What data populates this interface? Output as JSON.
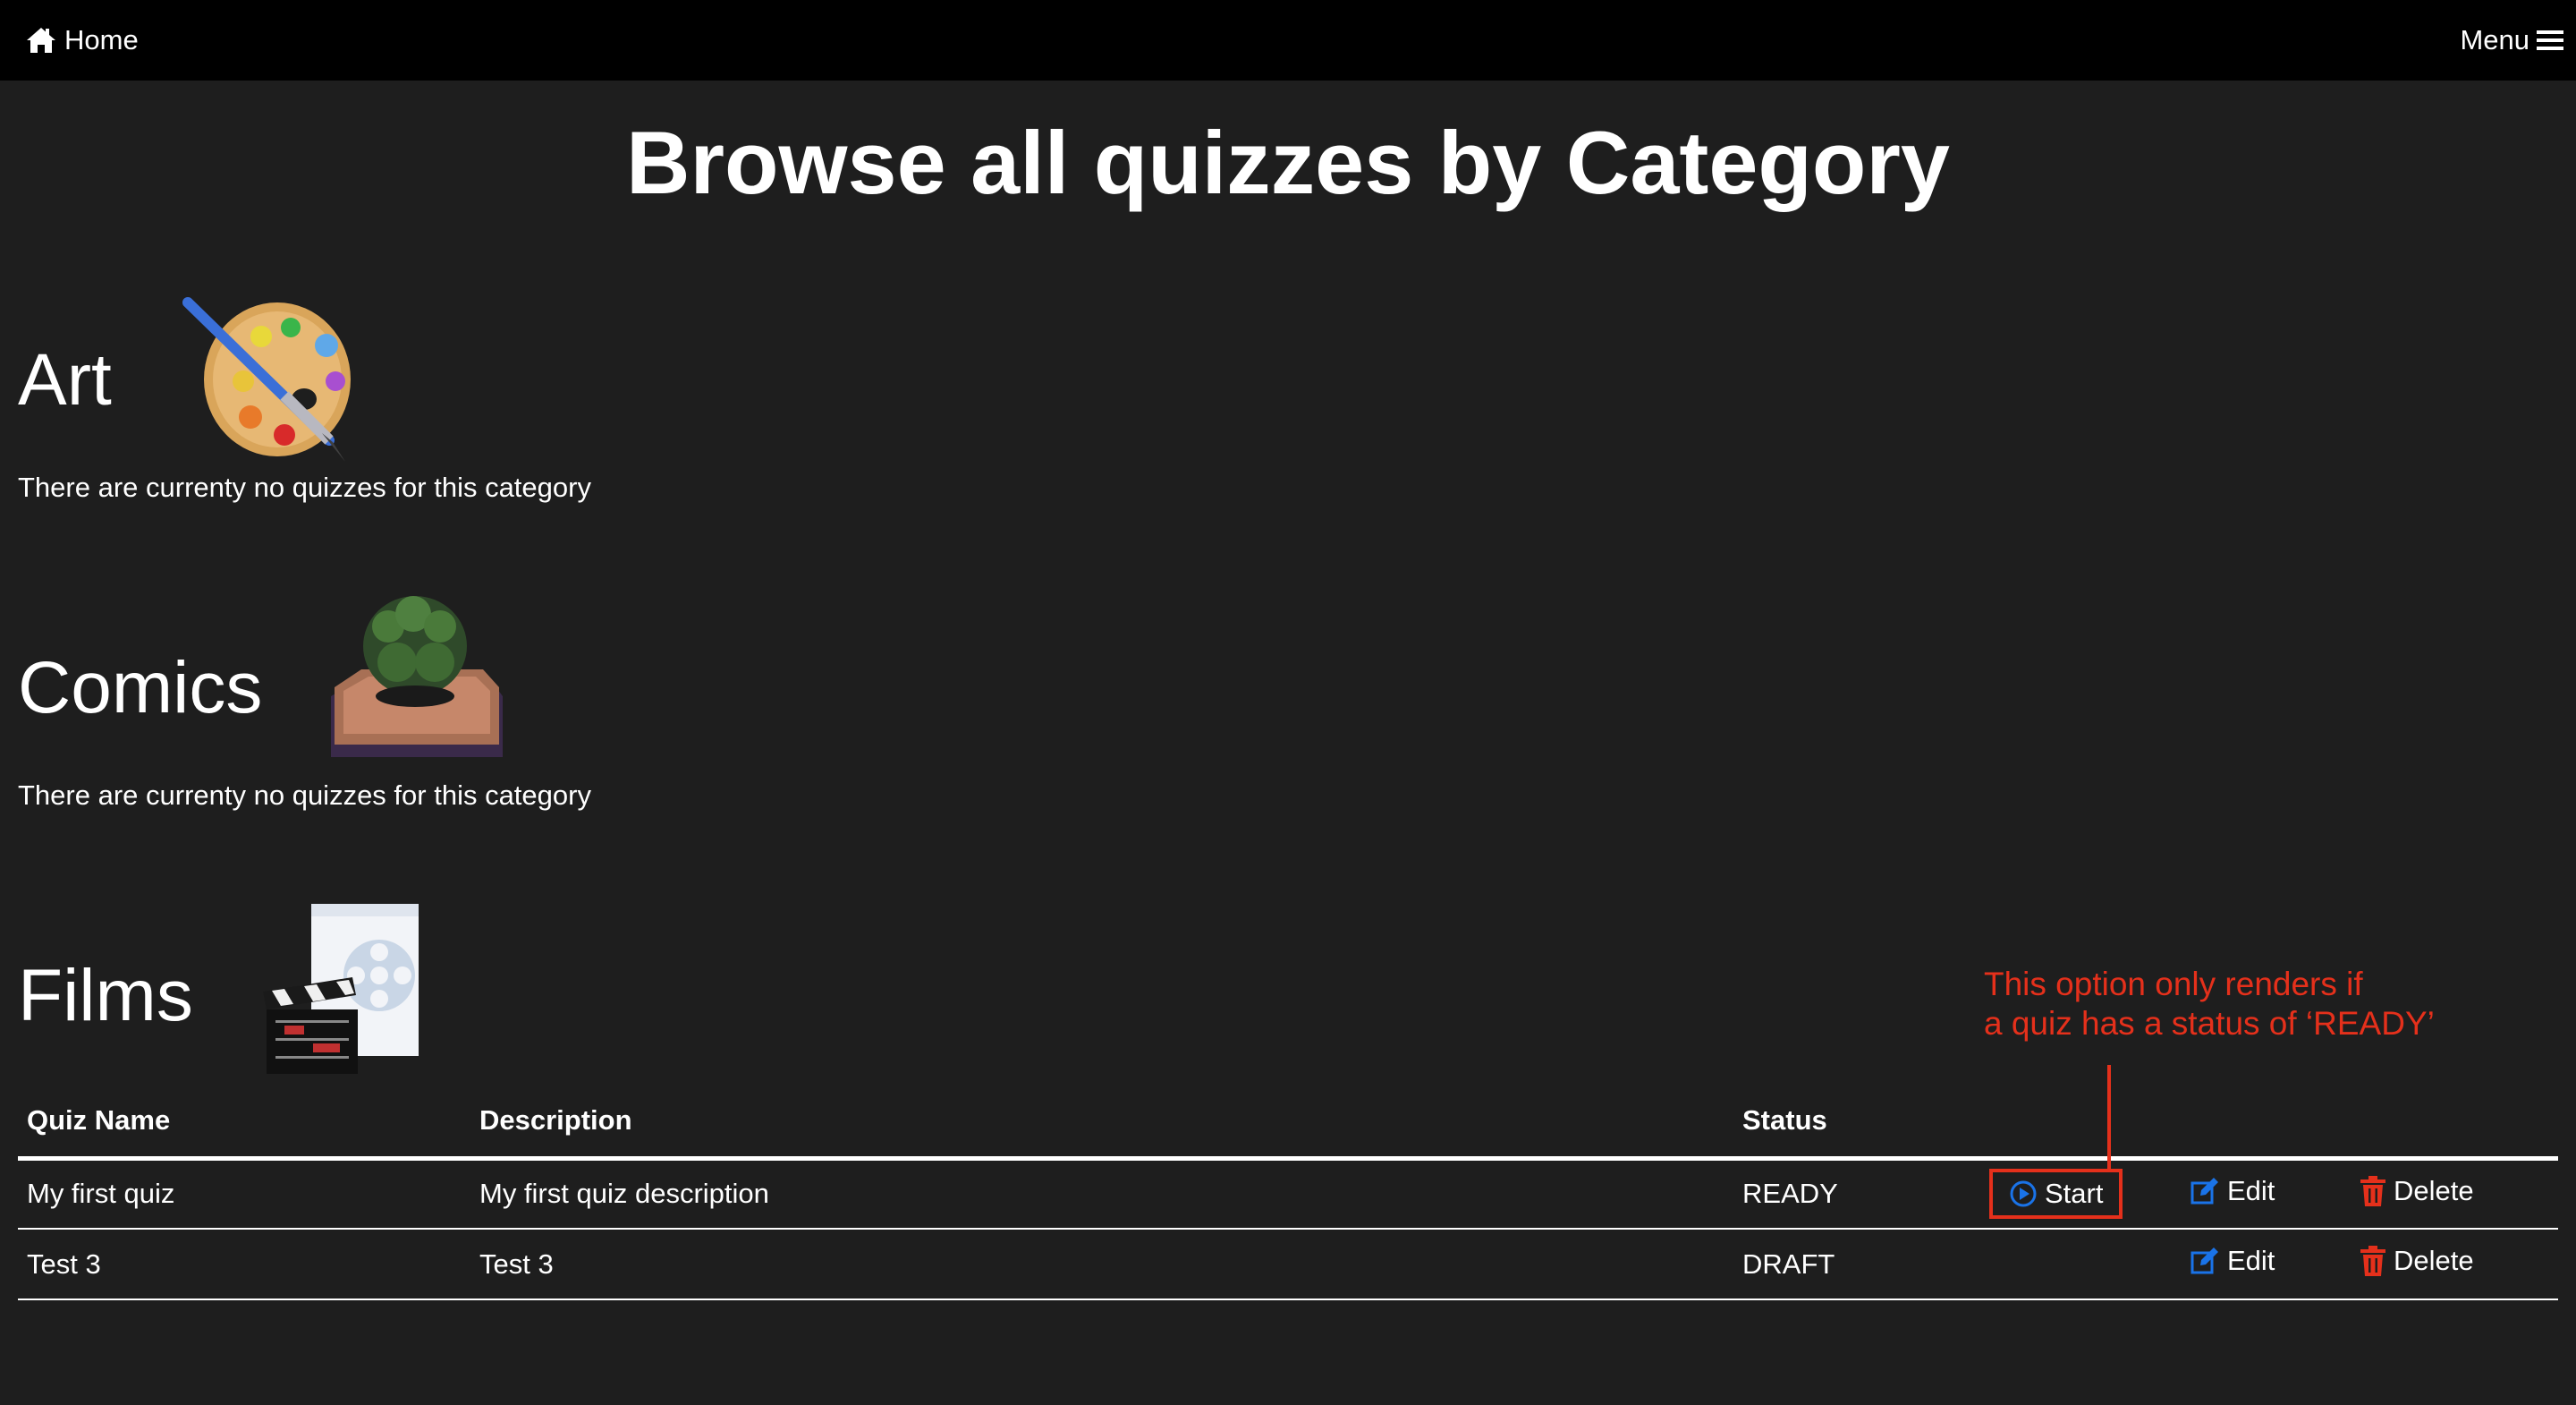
{
  "nav": {
    "home_label": "Home",
    "menu_label": "Menu"
  },
  "page_title": "Browse all quizzes by Category",
  "categories": [
    {
      "name": "Art",
      "empty_message": "There are currenty no quizzes for this category",
      "icon": "palette-icon"
    },
    {
      "name": "Comics",
      "empty_message": "There are currenty no quizzes for this category",
      "icon": "comic-fist-icon"
    },
    {
      "name": "Films",
      "icon": "film-clapper-icon"
    }
  ],
  "table": {
    "headers": {
      "name": "Quiz Name",
      "description": "Description",
      "status": "Status"
    },
    "rows": [
      {
        "name": "My first quiz",
        "description": "My first quiz description",
        "status": "READY",
        "start": "Start",
        "edit": "Edit",
        "delete": "Delete"
      },
      {
        "name": "Test 3",
        "description": "Test 3",
        "status": "DRAFT",
        "edit": "Edit",
        "delete": "Delete"
      }
    ]
  },
  "annotation": {
    "line1": "This option only renders if",
    "line2": "a quiz has a status of ‘READY’"
  },
  "colors": {
    "background": "#1e1e1e",
    "navbar": "#000000",
    "start_icon": "#1a73e8",
    "edit_icon": "#1a73e8",
    "delete_icon": "#e5301b",
    "annotation": "#e5301b"
  }
}
